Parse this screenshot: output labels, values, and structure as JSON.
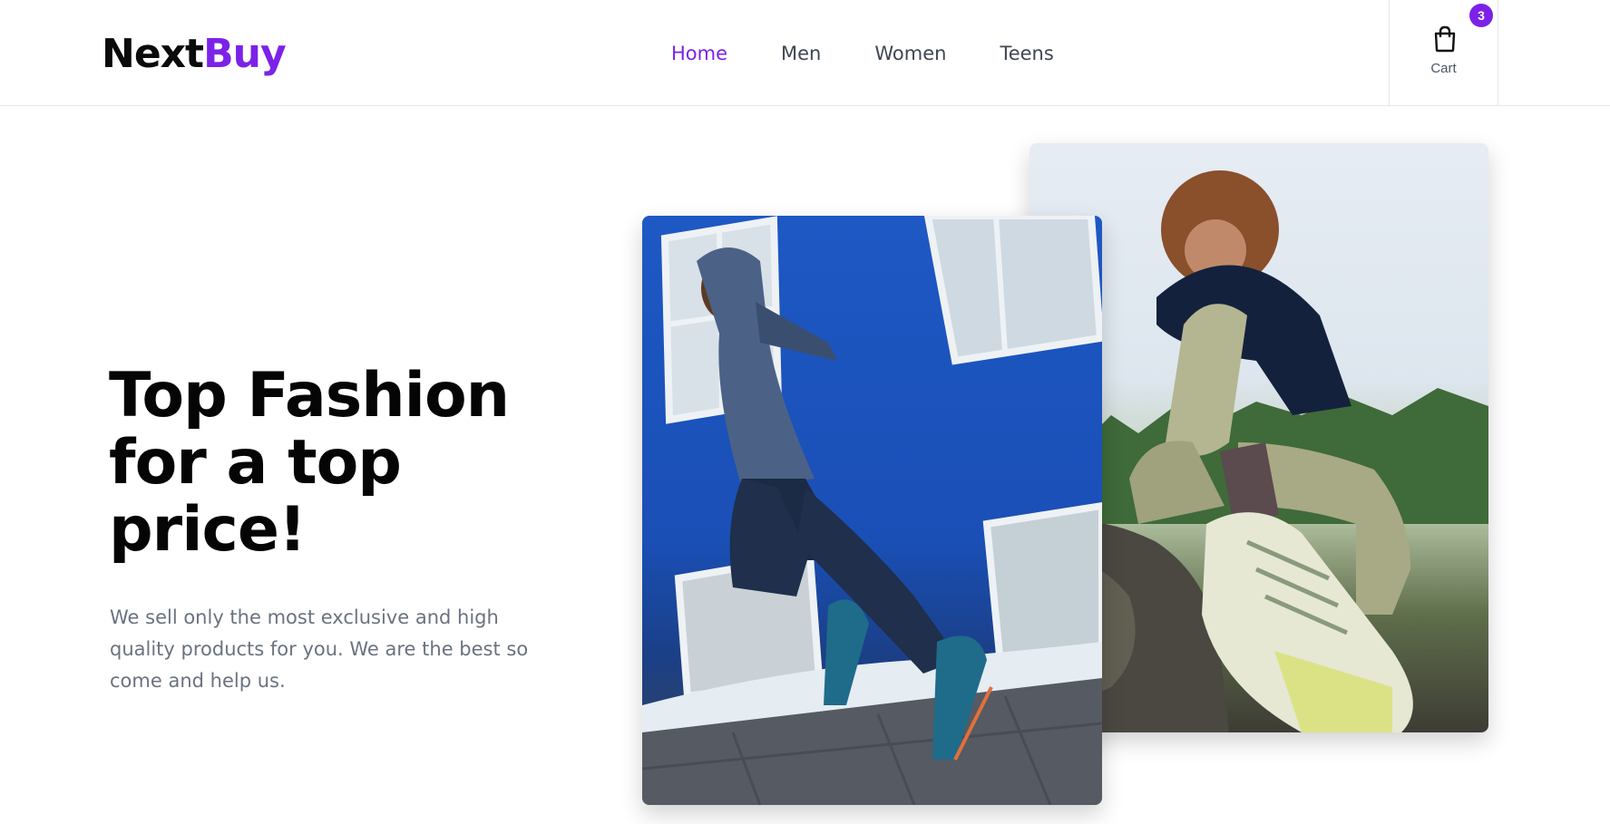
{
  "brand": {
    "part1": "Next",
    "part2": "Buy",
    "accent": "#7c22e8"
  },
  "nav": {
    "items": [
      {
        "label": "Home",
        "active": true
      },
      {
        "label": "Men",
        "active": false
      },
      {
        "label": "Women",
        "active": false
      },
      {
        "label": "Teens",
        "active": false
      }
    ]
  },
  "cart": {
    "label": "Cart",
    "count": "3",
    "icon": "shopping-bag-icon"
  },
  "hero": {
    "title_line1": "Top Fashion",
    "title_line2": "for a top",
    "title_line3": "price!",
    "description": "We sell only the most exclusive and high quality products for you. We are the best so come and help us."
  },
  "images": {
    "front": "man-running-photo",
    "back": "woman-sitting-sneakers-photo"
  }
}
